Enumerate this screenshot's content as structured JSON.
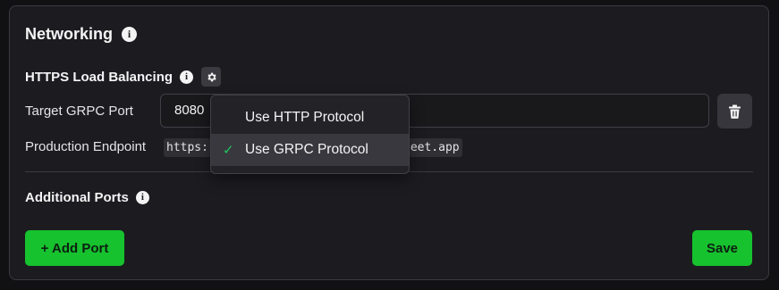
{
  "networking": {
    "title": "Networking",
    "info_icon": "info-icon"
  },
  "https_lb": {
    "title": "HTTPS Load Balancing",
    "info_icon": "info-icon",
    "settings_icon": "gear-icon",
    "target_port_label": "Target GRPC Port",
    "target_port_value": "8080",
    "delete_icon": "trash-icon",
    "endpoint_label": "Production Endpoint",
    "endpoint_left": "https:",
    "endpoint_right": "zeet.app"
  },
  "protocol_menu": {
    "items": [
      {
        "label": "Use HTTP Protocol",
        "selected": false
      },
      {
        "label": "Use GRPC Protocol",
        "selected": true
      }
    ],
    "check_glyph": "✓",
    "check_color": "#22c55e"
  },
  "additional_ports": {
    "title": "Additional Ports",
    "info_icon": "info-icon",
    "add_button": "+ Add Port"
  },
  "save_button": "Save",
  "colors": {
    "accent_green": "#16c22e",
    "panel_bg": "#1c1c20",
    "page_bg": "#111114"
  }
}
